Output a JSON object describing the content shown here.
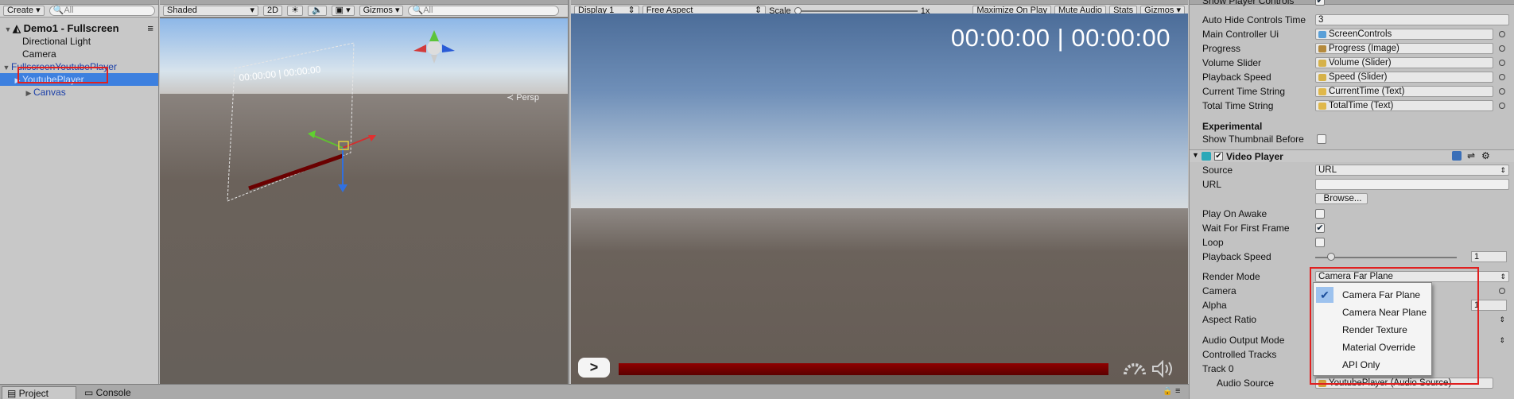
{
  "hierarchy": {
    "create_label": "Create",
    "search_placeholder": "All",
    "scene_name": "Demo1 - Fullscreen",
    "items": [
      "Directional Light",
      "Camera",
      "FullscreenYoutubePlayer",
      "YoutubePlayer",
      "Canvas"
    ]
  },
  "scene": {
    "shading_mode": "Shaded",
    "mode_2d": "2D",
    "gizmos_label": "Gizmos",
    "search_placeholder": "All",
    "persp_label": "Persp",
    "canvas_time_text": "00:00:00 | 00:00:00"
  },
  "game": {
    "display_label": "Display 1",
    "aspect_label": "Free Aspect",
    "scale_label": "Scale",
    "scale_value": "1x",
    "maximize_label": "Maximize On Play",
    "mute_label": "Mute Audio",
    "stats_label": "Stats",
    "gizmos_label": "Gizmos",
    "time_text": "00:00:00 | 00:00:00",
    "play_symbol": ">"
  },
  "inspector": {
    "top_partial": "Show Player Controls",
    "rows": [
      {
        "label": "Auto Hide Controls Time",
        "value": "3"
      },
      {
        "label": "Main Controller Ui",
        "value": "ScreenControls"
      },
      {
        "label": "Progress",
        "value": "Progress (Image)"
      },
      {
        "label": "Volume Slider",
        "value": "Volume (Slider)"
      },
      {
        "label": "Playback Speed",
        "value": "Speed (Slider)"
      },
      {
        "label": "Current Time String",
        "value": "CurrentTime (Text)"
      },
      {
        "label": "Total Time String",
        "value": "TotalTime (Text)"
      }
    ],
    "experimental_header": "Experimental",
    "show_thumbnail_label": "Show Thumbnail Before",
    "video_player_title": "Video Player",
    "source_label": "Source",
    "source_value": "URL",
    "url_label": "URL",
    "browse_label": "Browse...",
    "play_on_awake_label": "Play On Awake",
    "wait_first_frame_label": "Wait For First Frame",
    "loop_label": "Loop",
    "playback_speed_label": "Playback Speed",
    "playback_speed_value": "1",
    "render_mode_label": "Render Mode",
    "render_mode_value": "Camera Far Plane",
    "camera_label": "Camera",
    "alpha_label": "Alpha",
    "alpha_value": "1",
    "aspect_ratio_label": "Aspect Ratio",
    "audio_output_label": "Audio Output Mode",
    "controlled_tracks_label": "Controlled Tracks",
    "track0_label": "Track 0",
    "audio_source_label": "Audio Source",
    "audio_source_value": "YoutubePlayer (Audio Source)"
  },
  "render_mode_options": [
    "Camera Far Plane",
    "Camera Near Plane",
    "Render Texture",
    "Material Override",
    "API Only"
  ],
  "bottom_tabs": {
    "project": "Project",
    "console": "Console"
  },
  "colors": {
    "selection": "#3d80df",
    "highlight_box": "#e02020",
    "progress_bar": "#7a0000"
  }
}
